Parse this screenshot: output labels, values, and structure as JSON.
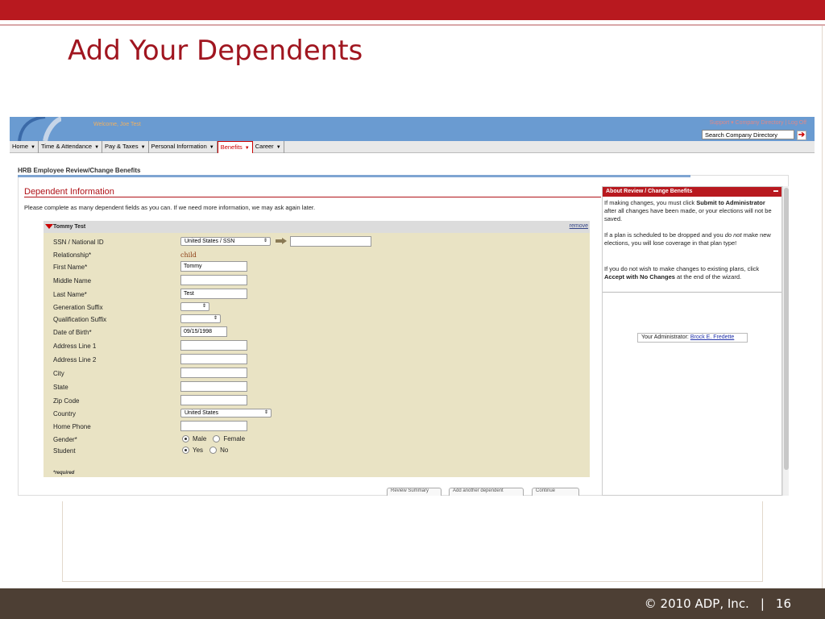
{
  "slide": {
    "title": "Add Your Dependents",
    "footer_copyright": "© 2010 ADP, Inc.",
    "footer_separator": "|",
    "footer_page": "16"
  },
  "app": {
    "welcome": "Welcome, Joe Test",
    "util_links": "Support ▾   Company Directory  |  Log Off",
    "search_value": "Search Company Directory",
    "menu": [
      {
        "label": "Home"
      },
      {
        "label": "Time & Attendance"
      },
      {
        "label": "Pay & Taxes"
      },
      {
        "label": "Personal Information"
      },
      {
        "label": "Benefits"
      },
      {
        "label": "Career"
      }
    ],
    "page_heading": "HRB Employee Review/Change Benefits",
    "section_title": "Dependent Information",
    "intro": "Please complete as many dependent fields as you can. If we need more information, we may ask again later.",
    "dependent": {
      "name": "Tommy Test",
      "remove": "remove",
      "labels": {
        "ssn": "SSN / National ID",
        "relationship": "Relationship*",
        "first_name": "First Name*",
        "middle_name": "Middle Name",
        "last_name": "Last Name*",
        "generation_suffix": "Generation Suffix",
        "qualification_suffix": "Qualification Suffix",
        "dob": "Date of Birth*",
        "address1": "Address Line 1",
        "address2": "Address Line 2",
        "city": "City",
        "state": "State",
        "zip": "Zip Code",
        "country": "Country",
        "home_phone": "Home Phone",
        "gender": "Gender*",
        "student": "Student"
      },
      "values": {
        "ssn_type": "United States / SSN",
        "ssn": "",
        "relationship": "child",
        "first_name": "Tommy",
        "middle_name": "",
        "last_name": "Test",
        "generation_suffix": "",
        "qualification_suffix": "",
        "dob": "09/15/1998",
        "address1": "",
        "address2": "",
        "city": "",
        "state": "",
        "zip": "",
        "country": "United States",
        "home_phone": ""
      },
      "gender_options": [
        "Male",
        "Female"
      ],
      "gender_selected": "Male",
      "student_options": [
        "Yes",
        "No"
      ],
      "student_selected": "Yes",
      "required_note": "*required"
    },
    "buttons_cut": [
      "Review Summary",
      "Add another dependent",
      "Continue"
    ],
    "side": {
      "title": "About Review / Change Benefits",
      "para1_a": "If making changes, you must click ",
      "para1_b": "Submit to Administrator",
      "para1_c": " after all changes have been made, or your elections will not be saved.",
      "para2_a": "If a plan is scheduled to be dropped and you ",
      "para2_b": "do not",
      "para2_c": " make new elections, you will lose coverage in that plan type!",
      "para3_a": "If you do not wish to make changes to existing plans, click ",
      "para3_b": "Accept with No Changes",
      "para3_c": " at the end of the wizard.",
      "admin_label": "Your Administrator:",
      "admin_name": "Brock E. Fredette"
    }
  }
}
